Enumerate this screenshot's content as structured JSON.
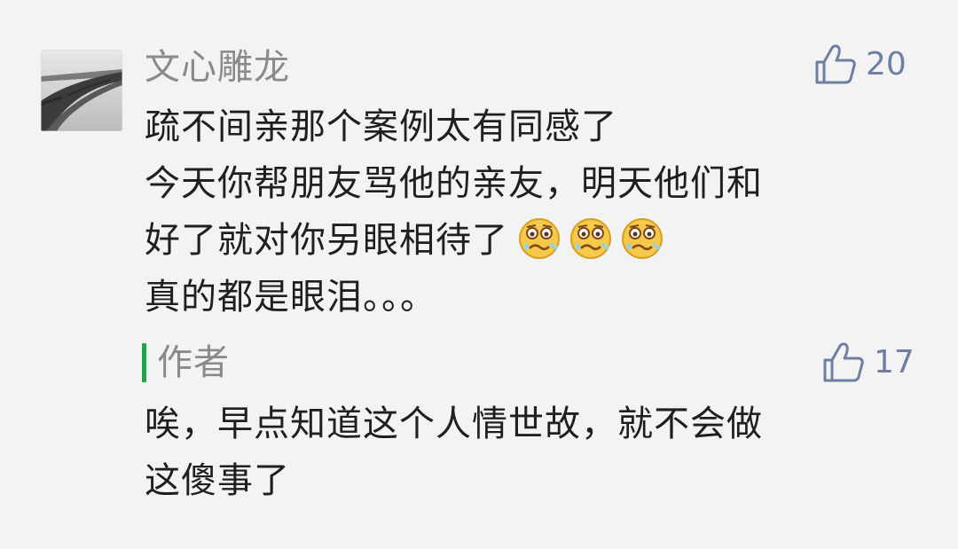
{
  "comment": {
    "author": "文心雕龙",
    "likes": "20",
    "text_lines": [
      "疏不间亲那个案例太有同感了",
      "今天你帮朋友骂他的亲友，明天他们和",
      "好了就对你另眼相待了",
      "真的都是眼泪。。。"
    ],
    "emoji_name": "tearful-face-emoji",
    "emoji_count": 3
  },
  "reply": {
    "author": "作者",
    "likes": "17",
    "text_lines": [
      "唉，早点知道这个人情世故，就不会做",
      "这傻事了"
    ]
  },
  "colors": {
    "background": "#f3f3f3",
    "author": "#8a8a8a",
    "like": "#6f7fa2",
    "reply_bar": "#19a64a",
    "text": "#1f1f1f"
  }
}
